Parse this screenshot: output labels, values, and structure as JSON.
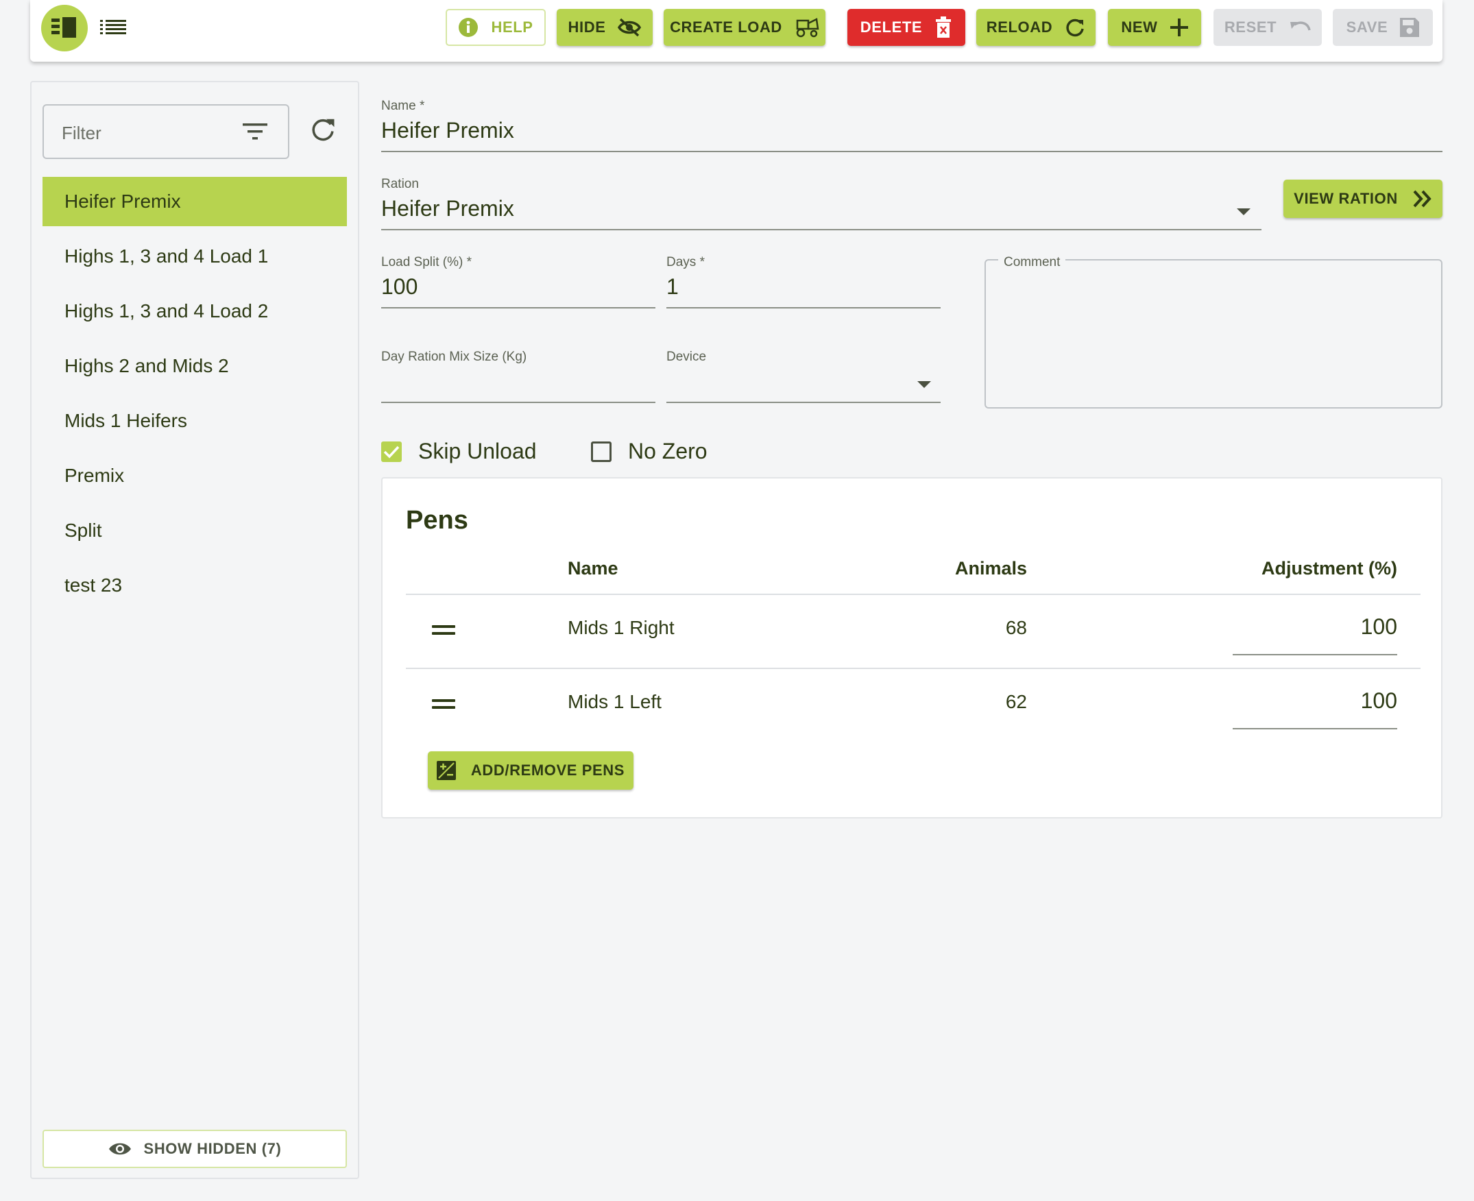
{
  "toolbar": {
    "buttons": {
      "help": "HELP",
      "hide": "HIDE",
      "create_load": "CREATE LOAD",
      "delete": "DELETE",
      "reload": "RELOAD",
      "new": "NEW",
      "reset": "RESET",
      "save": "SAVE"
    },
    "icons": {
      "active_view": "split-view-icon",
      "list_view": "list-view-icon"
    }
  },
  "sidebar": {
    "filter_placeholder": "Filter",
    "items": [
      {
        "label": "Heifer Premix",
        "selected": true
      },
      {
        "label": "Highs 1, 3 and 4 Load 1"
      },
      {
        "label": "Highs 1, 3 and 4 Load 2"
      },
      {
        "label": "Highs 2 and Mids 2"
      },
      {
        "label": "Mids 1 Heifers"
      },
      {
        "label": "Premix"
      },
      {
        "label": "Split"
      },
      {
        "label": "test 23"
      }
    ],
    "show_hidden": "SHOW HIDDEN (7)"
  },
  "form": {
    "name": {
      "label": "Name *",
      "value": "Heifer Premix"
    },
    "ration": {
      "label": "Ration",
      "value": "Heifer Premix"
    },
    "view_ration": "VIEW RATION",
    "load_split": {
      "label": "Load Split (%) *",
      "value": "100"
    },
    "days": {
      "label": "Days *",
      "value": "1"
    },
    "day_ration_mix_size": {
      "label": "Day Ration Mix Size (Kg)",
      "value": ""
    },
    "device": {
      "label": "Device",
      "value": ""
    },
    "comment": {
      "label": "Comment",
      "value": ""
    },
    "skip_unload": {
      "label": "Skip Unload",
      "checked": true
    },
    "no_zero": {
      "label": "No Zero",
      "checked": false
    }
  },
  "pens": {
    "title": "Pens",
    "columns": {
      "name": "Name",
      "animals": "Animals",
      "adjustment": "Adjustment (%)"
    },
    "rows": [
      {
        "name": "Mids 1 Right",
        "animals": "68",
        "adjustment": "100"
      },
      {
        "name": "Mids 1 Left",
        "animals": "62",
        "adjustment": "100"
      }
    ],
    "add_remove": "ADD/REMOVE PENS"
  },
  "colors": {
    "accent": "#b7d34f",
    "danger": "#df2c2c",
    "text": "#2d3a14",
    "background": "#f4f5f6"
  }
}
